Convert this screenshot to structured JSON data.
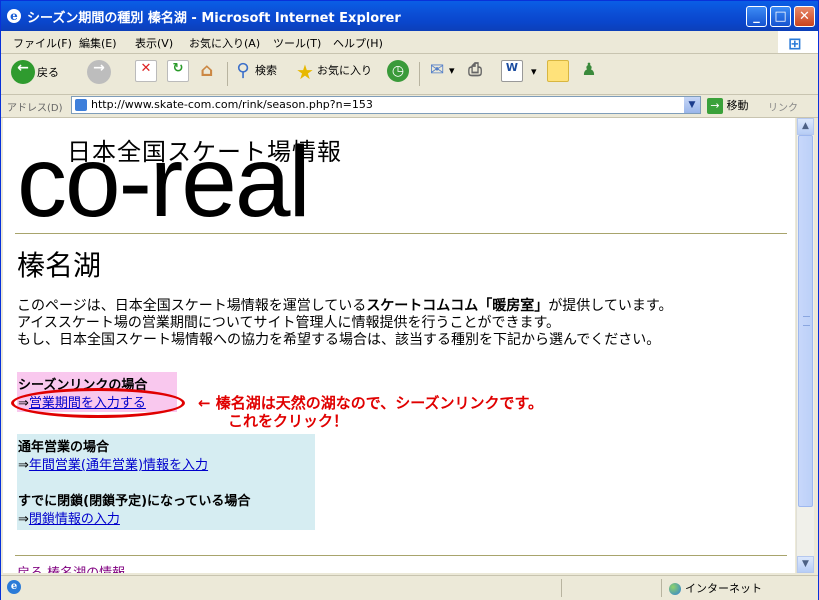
{
  "window": {
    "title": "シーズン期間の種別 榛名湖 - Microsoft Internet Explorer",
    "minimize": "_",
    "maximize": "□",
    "close": "✕"
  },
  "menu": [
    "ファイル(F)",
    "編集(E)",
    "表示(V)",
    "お気に入り(A)",
    "ツール(T)",
    "ヘルプ(H)"
  ],
  "toolbar": {
    "back_label": "戻る",
    "search_label": "検索",
    "favorites_label": "お気に入り"
  },
  "address": {
    "label": "アドレス(D)",
    "url": "http://www.skate-com.com/rink/season.php?n=153",
    "go_label": "移動",
    "links_label": "リンク"
  },
  "page": {
    "logo_subtitle": "日本全国スケート場情報",
    "logo_main": "co-real",
    "heading": "榛名湖",
    "intro_line1_a": "このページは、日本全国スケート場情報を運営している",
    "intro_line1_bold": "スケートコムコム「暖房室」",
    "intro_line1_b": "が提供しています。",
    "intro_line2": "アイススケート場の営業期間についてサイト管理人に情報提供を行うことができます。",
    "intro_line3": "もし、日本全国スケート場情報への協力を希望する場合は、該当する種別を下記から選んでください。",
    "season_title": "シーズンリンクの場合",
    "arrow": "⇒",
    "season_link": "営業期間を入力する",
    "annual_title": "通年営業の場合",
    "annual_link": "年間営業(通年営業)情報を入力",
    "closed_title": "すでに閉鎖(閉鎖予定)になっている場合",
    "closed_link": "閉鎖情報の入力",
    "back_link": "戻る 榛名湖の情報"
  },
  "annotation": {
    "line1": "← 榛名湖は天然の湖なので、シーズンリンクです。",
    "line2": "これをクリック！",
    "color": "#e00000"
  },
  "status": {
    "zone": "インターネット"
  }
}
